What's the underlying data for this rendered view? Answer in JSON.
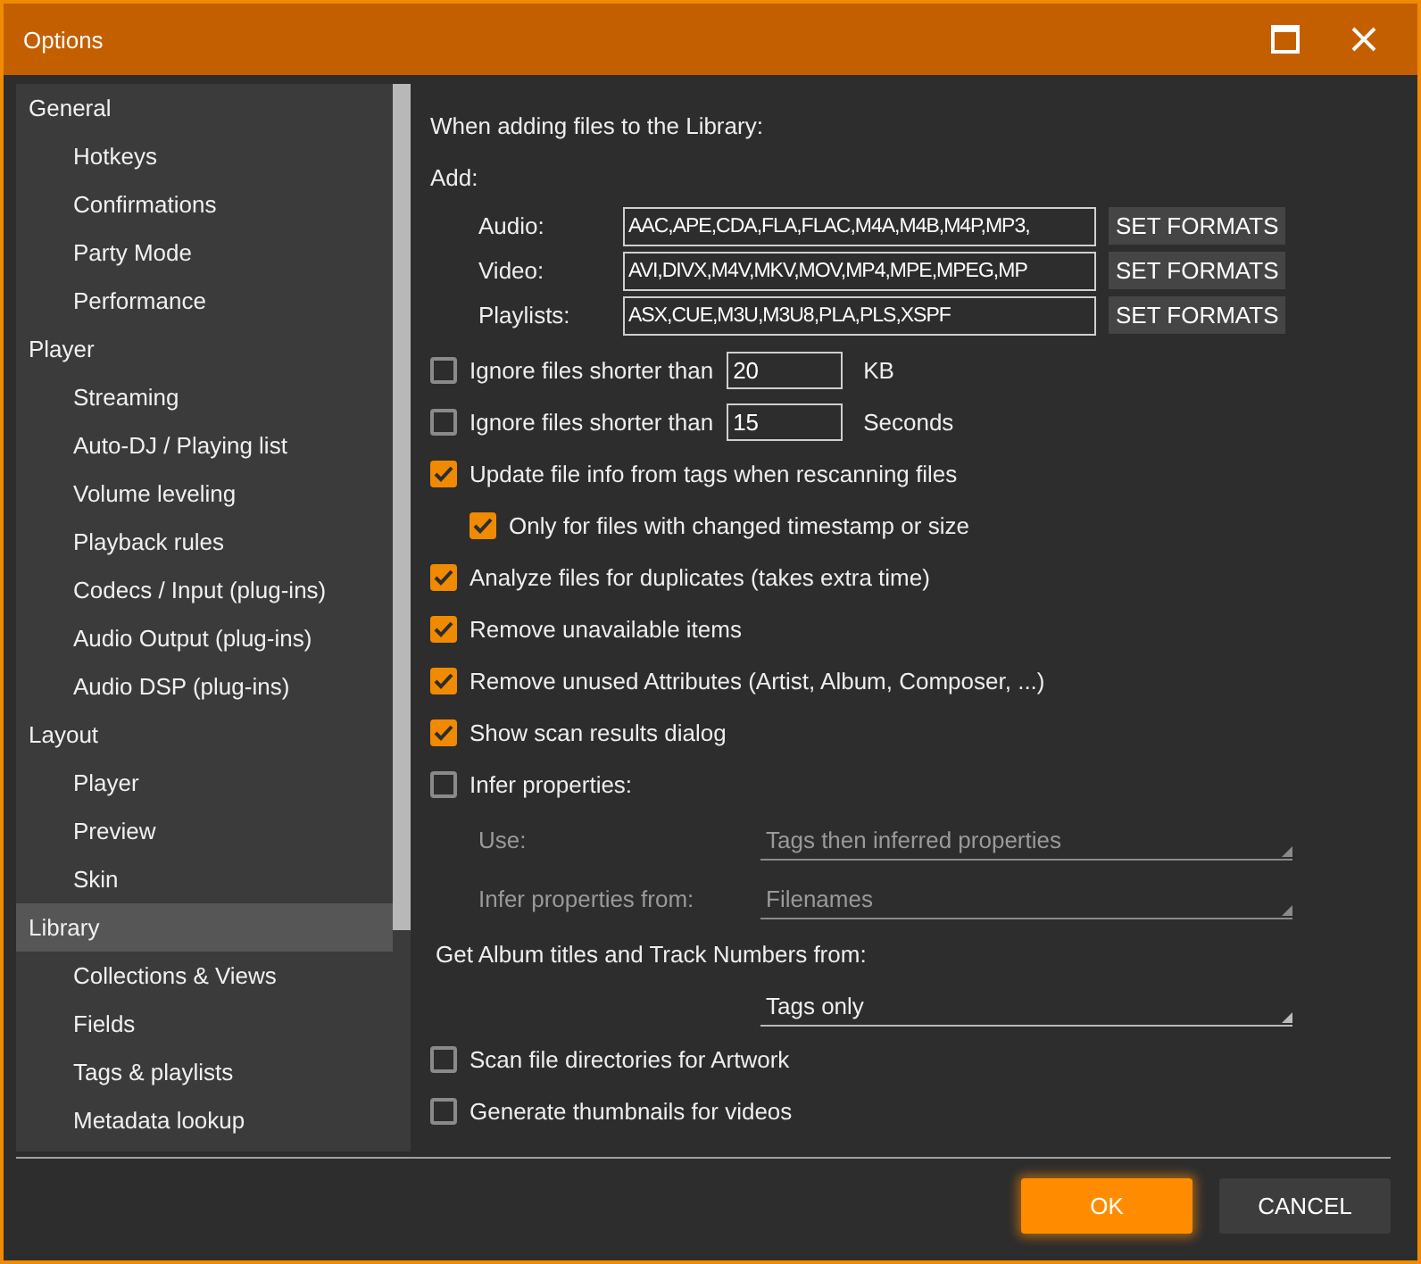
{
  "window": {
    "title": "Options"
  },
  "sidebar": {
    "items": [
      {
        "label": "General",
        "selected": false,
        "children": [
          {
            "label": "Hotkeys",
            "selected": false
          },
          {
            "label": "Confirmations",
            "selected": false
          },
          {
            "label": "Party Mode",
            "selected": false
          },
          {
            "label": "Performance",
            "selected": false
          }
        ]
      },
      {
        "label": "Player",
        "selected": false,
        "children": [
          {
            "label": "Streaming",
            "selected": false
          },
          {
            "label": "Auto-DJ / Playing list",
            "selected": false
          },
          {
            "label": "Volume leveling",
            "selected": false
          },
          {
            "label": "Playback rules",
            "selected": false
          },
          {
            "label": "Codecs / Input (plug-ins)",
            "selected": false
          },
          {
            "label": "Audio Output (plug-ins)",
            "selected": false
          },
          {
            "label": "Audio DSP (plug-ins)",
            "selected": false
          }
        ]
      },
      {
        "label": "Layout",
        "selected": false,
        "children": [
          {
            "label": "Player",
            "selected": false
          },
          {
            "label": "Preview",
            "selected": false
          },
          {
            "label": "Skin",
            "selected": false
          }
        ]
      },
      {
        "label": "Library",
        "selected": true,
        "children": [
          {
            "label": "Collections & Views",
            "selected": false
          },
          {
            "label": "Fields",
            "selected": false
          },
          {
            "label": "Tags & playlists",
            "selected": false
          },
          {
            "label": "Metadata lookup",
            "selected": false
          }
        ]
      }
    ]
  },
  "content": {
    "heading": "When adding files to the Library:",
    "add_label": "Add:",
    "formats": [
      {
        "label": "Audio:",
        "value": "AAC,APE,CDA,FLA,FLAC,M4A,M4B,M4P,MP3,",
        "button": "SET FORMATS"
      },
      {
        "label": "Video:",
        "value": "AVI,DIVX,M4V,MKV,MOV,MP4,MPE,MPEG,MP",
        "button": "SET FORMATS"
      },
      {
        "label": "Playlists:",
        "value": "ASX,CUE,M3U,M3U8,PLA,PLS,XSPF",
        "button": "SET FORMATS"
      }
    ],
    "settings": [
      {
        "kind": "check_input",
        "label": "Ignore files shorter than",
        "checked": false,
        "value": "20",
        "unit": "KB"
      },
      {
        "kind": "check_input",
        "label": "Ignore files shorter than",
        "checked": false,
        "value": "15",
        "unit": "Seconds"
      },
      {
        "kind": "check",
        "label": "Update file info from tags when rescanning files",
        "checked": true,
        "children": [
          {
            "kind": "check",
            "label": "Only for files with changed timestamp or size",
            "checked": true
          }
        ]
      },
      {
        "kind": "check",
        "label": "Analyze files for duplicates (takes extra time)",
        "checked": true
      },
      {
        "kind": "check",
        "label": "Remove unavailable items",
        "checked": true
      },
      {
        "kind": "check",
        "label": "Remove unused Attributes (Artist, Album, Composer, ...)",
        "checked": true
      },
      {
        "kind": "check",
        "label": "Show scan results dialog",
        "checked": true
      },
      {
        "kind": "check",
        "label": "Infer properties:",
        "checked": false,
        "children": [
          {
            "kind": "select",
            "label": "Use:",
            "value": "Tags then inferred properties",
            "disabled": true
          },
          {
            "kind": "select",
            "label": "Infer properties from:",
            "value": "Filenames",
            "disabled": true
          }
        ]
      },
      {
        "kind": "heading",
        "label": "Get Album titles and Track Numbers from:"
      },
      {
        "kind": "select",
        "value": "Tags only",
        "disabled": false
      },
      {
        "kind": "check",
        "label": "Scan file directories for Artwork",
        "checked": false
      },
      {
        "kind": "check",
        "label": "Generate thumbnails for videos",
        "checked": false
      }
    ]
  },
  "buttons": [
    {
      "label": "OK",
      "kind": "primary"
    },
    {
      "label": "CANCEL",
      "kind": "secondary"
    }
  ]
}
